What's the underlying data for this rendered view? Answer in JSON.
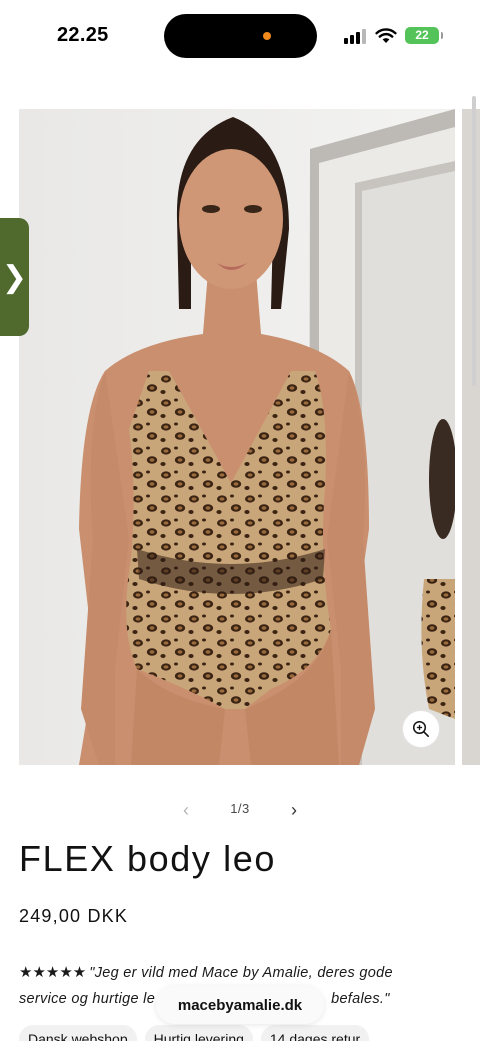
{
  "status_bar": {
    "time": "22.25",
    "battery_level": "22",
    "accent_colors": {
      "battery": "#54c35a",
      "island_indicator": "#f08a1c"
    }
  },
  "gallery": {
    "side_tab_glyph": "❯",
    "side_tab_color": "#4f6a2c",
    "zoom_icon": "magnifier-plus-icon",
    "pager": {
      "prev_glyph": "‹",
      "count": "1/3",
      "next_glyph": "›"
    }
  },
  "product": {
    "title": "FLEX body leo",
    "price": "249,00 DKK",
    "review": {
      "stars": "★★★★★",
      "text_line1": "\"Jeg er vild med Mace by Amalie, deres gode",
      "text_line2": "service og hurtige le",
      "text_line2_end": "befales.\""
    },
    "tags": [
      "Dansk webshop",
      "Hurtig levering",
      "14 dages retur"
    ]
  },
  "browser": {
    "url": "macebyamalie.dk"
  }
}
